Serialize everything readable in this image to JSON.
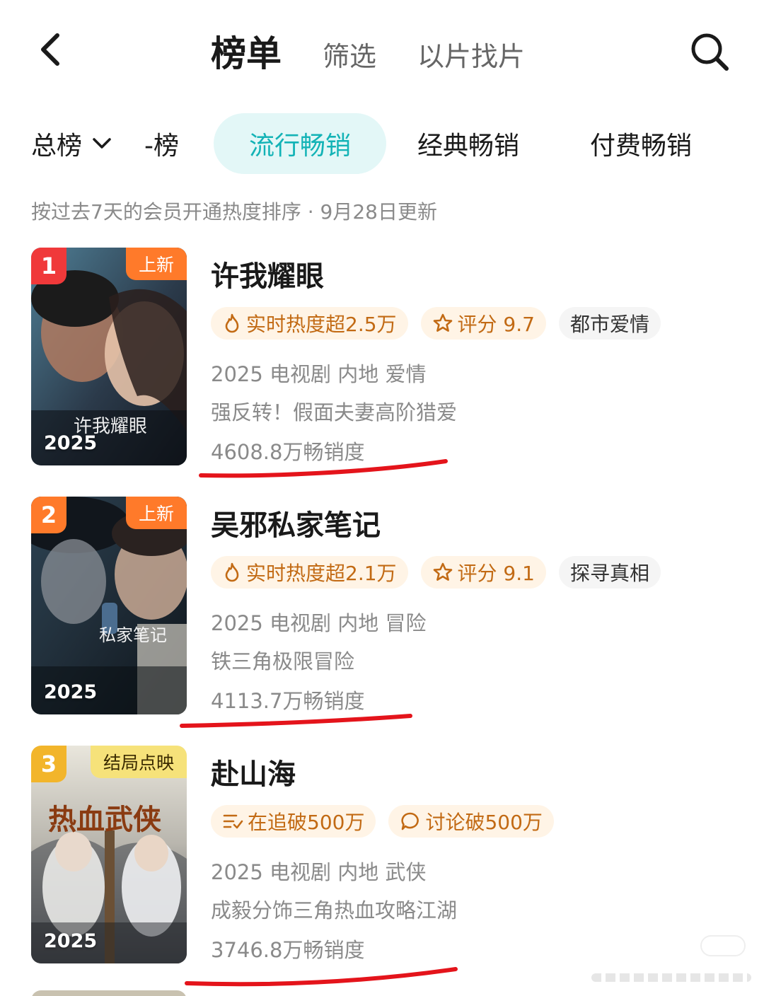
{
  "header": {
    "tabs": [
      {
        "label": "榜单",
        "active": true
      },
      {
        "label": "筛选",
        "active": false
      },
      {
        "label": "以片找片",
        "active": false
      }
    ]
  },
  "subtabs": {
    "dropdown_label": "总榜",
    "items": [
      "-榜",
      "流行畅销",
      "经典畅销",
      "付费畅销"
    ],
    "selected": "流行畅销"
  },
  "description": "按过去7天的会员开通热度排序 · 9月28日更新",
  "colors": {
    "accent": "#13b3b6",
    "highlight_bg": "#e3f7f7",
    "underline": "#e4141b"
  },
  "items": [
    {
      "rank": "1",
      "badge": "上新",
      "year": "2025",
      "poster_text": "许我耀眼",
      "title": "许我耀眼",
      "tags": [
        {
          "icon": "flame-icon",
          "label": "实时热度超2.5万"
        },
        {
          "icon": "star-icon",
          "label": "评分 9.7"
        },
        {
          "icon": "",
          "label": "都市爱情"
        }
      ],
      "meta": "2025 电视剧 内地 爱情",
      "tagline": "强反转！假面夫妻高阶猎爱",
      "sales": "4608.8万畅销度"
    },
    {
      "rank": "2",
      "badge": "上新",
      "year": "2025",
      "poster_text": "私家笔记",
      "title": "吴邪私家笔记",
      "tags": [
        {
          "icon": "flame-icon",
          "label": "实时热度超2.1万"
        },
        {
          "icon": "star-icon",
          "label": "评分 9.1"
        },
        {
          "icon": "",
          "label": "探寻真相"
        }
      ],
      "meta": "2025 电视剧 内地 冒险",
      "tagline": "铁三角极限冒险",
      "sales": "4113.7万畅销度"
    },
    {
      "rank": "3",
      "badge": "结局点映",
      "year": "2025",
      "poster_text": "热血武侠",
      "title": "赴山海",
      "tags": [
        {
          "icon": "list-icon",
          "label": "在追破500万"
        },
        {
          "icon": "chat-bubble-icon",
          "label": "讨论破500万"
        }
      ],
      "meta": "2025 电视剧 内地 武侠",
      "tagline": "成毅分饰三角热血攻略江湖",
      "sales": "3746.8万畅销度"
    }
  ]
}
